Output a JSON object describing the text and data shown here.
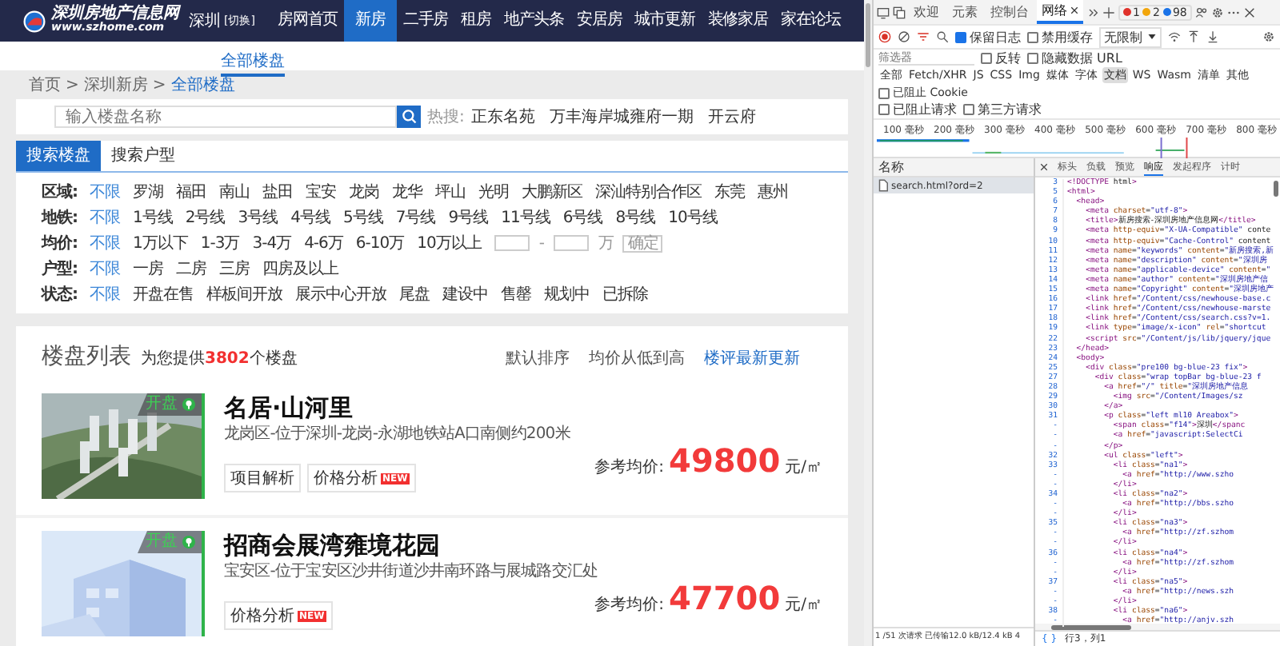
{
  "site": {
    "logo_title": "深圳房地产信息网",
    "logo_url": "www.szhome.com",
    "city": "深圳",
    "city_switch": "[切换]",
    "nav": [
      {
        "label": "房网首页",
        "selected": false
      },
      {
        "label": "新房",
        "selected": true
      },
      {
        "label": "二手房",
        "selected": false
      },
      {
        "label": "租房",
        "selected": false
      },
      {
        "label": "地产头条",
        "selected": false
      },
      {
        "label": "安居房",
        "selected": false
      },
      {
        "label": "城市更新",
        "selected": false
      },
      {
        "label": "装修家居",
        "selected": false
      },
      {
        "label": "家在论坛",
        "selected": false
      }
    ],
    "subnav": [
      {
        "label": "全部楼盘",
        "selected": true
      }
    ],
    "breadcrumb": [
      {
        "label": "首页",
        "current": false
      },
      {
        "label": "深圳新房",
        "current": false
      },
      {
        "label": "全部楼盘",
        "current": true
      }
    ],
    "breadcrumb_separators": [
      ">",
      ">"
    ],
    "search": {
      "placeholder": "输入楼盘名称",
      "hot_label": "热搜:",
      "hot": [
        "正东名苑",
        "万丰海岸城雍府一期",
        "开云府"
      ]
    },
    "tabs": [
      {
        "label": "搜索楼盘",
        "selected": true
      },
      {
        "label": "搜索户型",
        "selected": false
      }
    ],
    "filters": [
      {
        "label": "区域:",
        "kind": "options",
        "options": [
          {
            "label": "不限",
            "selected": true
          },
          {
            "label": "罗湖",
            "selected": false
          },
          {
            "label": "福田",
            "selected": false
          },
          {
            "label": "南山",
            "selected": false
          },
          {
            "label": "盐田",
            "selected": false
          },
          {
            "label": "宝安",
            "selected": false
          },
          {
            "label": "龙岗",
            "selected": false
          },
          {
            "label": "龙华",
            "selected": false
          },
          {
            "label": "坪山",
            "selected": false
          },
          {
            "label": "光明",
            "selected": false
          },
          {
            "label": "大鹏新区",
            "selected": false
          },
          {
            "label": "深汕特别合作区",
            "selected": false
          },
          {
            "label": "东莞",
            "selected": false
          },
          {
            "label": "惠州",
            "selected": false
          }
        ]
      },
      {
        "label": "地铁:",
        "kind": "options",
        "options": [
          {
            "label": "不限",
            "selected": true
          },
          {
            "label": "1号线",
            "selected": false
          },
          {
            "label": "2号线",
            "selected": false
          },
          {
            "label": "3号线",
            "selected": false
          },
          {
            "label": "4号线",
            "selected": false
          },
          {
            "label": "5号线",
            "selected": false
          },
          {
            "label": "7号线",
            "selected": false
          },
          {
            "label": "9号线",
            "selected": false
          },
          {
            "label": "11号线",
            "selected": false
          },
          {
            "label": "6号线",
            "selected": false
          },
          {
            "label": "8号线",
            "selected": false
          },
          {
            "label": "10号线",
            "selected": false
          }
        ]
      },
      {
        "label": "均价:",
        "kind": "range",
        "options": [
          {
            "label": "不限",
            "selected": true
          },
          {
            "label": "1万以下",
            "selected": false
          },
          {
            "label": "1-3万",
            "selected": false
          },
          {
            "label": "3-4万",
            "selected": false
          },
          {
            "label": "4-6万",
            "selected": false
          },
          {
            "label": "6-10万",
            "selected": false
          },
          {
            "label": "10万以上",
            "selected": false
          }
        ],
        "separator": "-",
        "unit": "万",
        "button": "确定"
      },
      {
        "label": "户型:",
        "kind": "options",
        "options": [
          {
            "label": "不限",
            "selected": true
          },
          {
            "label": "一房",
            "selected": false
          },
          {
            "label": "二房",
            "selected": false
          },
          {
            "label": "三房",
            "selected": false
          },
          {
            "label": "四房及以上",
            "selected": false
          }
        ]
      },
      {
        "label": "状态:",
        "kind": "options",
        "options": [
          {
            "label": "不限",
            "selected": true
          },
          {
            "label": "开盘在售",
            "selected": false
          },
          {
            "label": "样板间开放",
            "selected": false
          },
          {
            "label": "展示中心开放",
            "selected": false
          },
          {
            "label": "尾盘",
            "selected": false
          },
          {
            "label": "建设中",
            "selected": false
          },
          {
            "label": "售罄",
            "selected": false
          },
          {
            "label": "规划中",
            "selected": false
          },
          {
            "label": "已拆除",
            "selected": false
          }
        ]
      }
    ],
    "list": {
      "title": "楼盘列表",
      "count_prefix": "为您提供",
      "count": "3802",
      "count_suffix": "个楼盘",
      "sorts": [
        {
          "label": "默认排序",
          "selected": false
        },
        {
          "label": "均价从低到高",
          "selected": false
        },
        {
          "label": "楼评最新更新",
          "selected": true
        }
      ],
      "items": [
        {
          "name": "名居·山河里",
          "address": "龙岗区-位于深圳-龙岗-永湖地铁站A口南侧约200米",
          "status": "开盘",
          "tags": [
            {
              "label": "项目解析"
            },
            {
              "label": "价格分析",
              "badge": "NEW"
            }
          ],
          "price_label": "参考均价:",
          "price": "49800",
          "unit": "元/㎡"
        },
        {
          "name": "招商会展湾雍境花园",
          "address": "宝安区-位于宝安区沙井街道沙井南环路与展城路交汇处",
          "status": "开盘",
          "tags": [
            {
              "label": "价格分析",
              "badge": "NEW"
            }
          ],
          "price_label": "参考均价:",
          "price": "47700",
          "unit": "元/㎡"
        }
      ]
    }
  },
  "devtools": {
    "tabs": [
      {
        "label": "欢迎",
        "selected": false
      },
      {
        "label": "元素",
        "selected": false
      },
      {
        "label": "控制台",
        "selected": false
      },
      {
        "label": "网络",
        "selected": true
      }
    ],
    "counters": [
      {
        "count": "1",
        "color": "#e0322b"
      },
      {
        "count": "2",
        "color": "#f2a60c"
      },
      {
        "count": "98",
        "color": "#1a73e8"
      }
    ],
    "preserve_log": {
      "label": "保留日志",
      "checked": true
    },
    "disable_cache": {
      "label": "禁用缓存",
      "checked": false
    },
    "throttle": "无限制",
    "filter_placeholder": "筛选器",
    "invert": {
      "label": "反转",
      "checked": false
    },
    "hide_data_urls": {
      "label": "隐藏数据 URL",
      "checked": false
    },
    "types": [
      {
        "label": "全部",
        "selected": false
      },
      {
        "label": "Fetch/XHR",
        "selected": false
      },
      {
        "label": "JS",
        "selected": false
      },
      {
        "label": "CSS",
        "selected": false
      },
      {
        "label": "Img",
        "selected": false
      },
      {
        "label": "媒体",
        "selected": false
      },
      {
        "label": "字体",
        "selected": false
      },
      {
        "label": "文档",
        "selected": true
      },
      {
        "label": "WS",
        "selected": false
      },
      {
        "label": "Wasm",
        "selected": false
      },
      {
        "label": "清单",
        "selected": false
      },
      {
        "label": "其他",
        "selected": false
      }
    ],
    "blocked_cookies": {
      "label": "已阻止 Cookie",
      "checked": false
    },
    "blocked_requests": {
      "label": "已阻止请求",
      "checked": false
    },
    "third_party": {
      "label": "第三方请求",
      "checked": false
    },
    "timeline_ticks": [
      "100 毫秒",
      "200 毫秒",
      "300 毫秒",
      "400 毫秒",
      "500 毫秒",
      "600 毫秒",
      "700 毫秒",
      "800 毫秒"
    ],
    "requests_header": "名称",
    "requests": [
      {
        "name": "search.html?ord=2",
        "selected": true
      }
    ],
    "detail_tabs": [
      {
        "label": "标头",
        "selected": false
      },
      {
        "label": "负载",
        "selected": false
      },
      {
        "label": "预览",
        "selected": false
      },
      {
        "label": "响应",
        "selected": true
      },
      {
        "label": "发起程序",
        "selected": false
      },
      {
        "label": "计时",
        "selected": false
      }
    ],
    "code": [
      {
        "num": "3",
        "text": "<!DOCTYPE html>"
      },
      {
        "num": "5",
        "text": "<html>"
      },
      {
        "num": "6",
        "text": "  <head>"
      },
      {
        "num": "7",
        "text": "    <meta charset=\"utf-8\">"
      },
      {
        "num": "8",
        "text": "    <title>新房搜索-深圳房地产信息网</title>"
      },
      {
        "num": "9",
        "text": "    <meta http-equiv=\"X-UA-Compatible\" conte"
      },
      {
        "num": "10",
        "text": "    <meta http-equiv=\"Cache-Control\" content"
      },
      {
        "num": "11",
        "text": "    <meta name=\"keywords\" content=\"新房搜索,新"
      },
      {
        "num": "12",
        "text": "    <meta name=\"description\" content=\"深圳房"
      },
      {
        "num": "13",
        "text": "    <meta name=\"applicable-device\" content=\""
      },
      {
        "num": "14",
        "text": "    <meta name=\"author\" content=\"深圳房地产信"
      },
      {
        "num": "15",
        "text": "    <meta name=\"Copyright\" content=\"深圳房地产"
      },
      {
        "num": "16",
        "text": "    <link href=\"/Content/css/newhouse-base.c"
      },
      {
        "num": "17",
        "text": "    <link href=\"/Content/css/newhouse-marste"
      },
      {
        "num": "18",
        "text": "    <link href=\"/Content/css/search.css?v=1."
      },
      {
        "num": "19",
        "text": "    <link type=\"image/x-icon\" rel=\"shortcut"
      },
      {
        "num": "22",
        "text": "    <script src=\"/Content/js/lib/jquery/jque"
      },
      {
        "num": "23",
        "text": "  </head>"
      },
      {
        "num": "24",
        "text": "  <body>"
      },
      {
        "num": "25",
        "text": "    <div class=\"pre100 bg-blue-23 fix\">"
      },
      {
        "num": "27",
        "text": "      <div class=\"wrap topBar bg-blue-23 f"
      },
      {
        "num": "28",
        "text": "        <a href=\"/\" title=\"深圳房地产信息"
      },
      {
        "num": "29",
        "text": "          <img src=\"/Content/Images/sz"
      },
      {
        "num": "30",
        "text": "        </a>"
      },
      {
        "num": "31",
        "text": "        <p class=\"left ml10 Areabox\">"
      },
      {
        "num": "-",
        "text": "          <span class=\"f14\">深圳</spanc"
      },
      {
        "num": "-",
        "text": "          <a href=\"javascript:SelectCi"
      },
      {
        "num": "-",
        "text": "        </p>"
      },
      {
        "num": "32",
        "text": "        <ul class=\"left\">"
      },
      {
        "num": "33",
        "text": "          <li class=\"na1\">"
      },
      {
        "num": "-",
        "text": "            <a href=\"http://www.szho"
      },
      {
        "num": "-",
        "text": "          </li>"
      },
      {
        "num": "34",
        "text": "          <li class=\"na2\">"
      },
      {
        "num": "-",
        "text": "            <a href=\"http://bbs.szho"
      },
      {
        "num": "-",
        "text": "          </li>"
      },
      {
        "num": "35",
        "text": "          <li class=\"na3\">"
      },
      {
        "num": "-",
        "text": "            <a href=\"http://zf.szhom"
      },
      {
        "num": "-",
        "text": "          </li>"
      },
      {
        "num": "36",
        "text": "          <li class=\"na4\">"
      },
      {
        "num": "-",
        "text": "            <a href=\"http://zf.szhom"
      },
      {
        "num": "-",
        "text": "          </li>"
      },
      {
        "num": "37",
        "text": "          <li class=\"na5\">"
      },
      {
        "num": "-",
        "text": "            <a href=\"http://news.szh"
      },
      {
        "num": "-",
        "text": "          </li>"
      },
      {
        "num": "38",
        "text": "          <li class=\"na6\">"
      },
      {
        "num": "-",
        "text": "            <a href=\"http://anjv.szh"
      }
    ],
    "status": "1 /51 次请求  已传输12.0 kB/12.4 kB  4",
    "pretty_print": "{ }",
    "cursor": "行3，列1"
  }
}
